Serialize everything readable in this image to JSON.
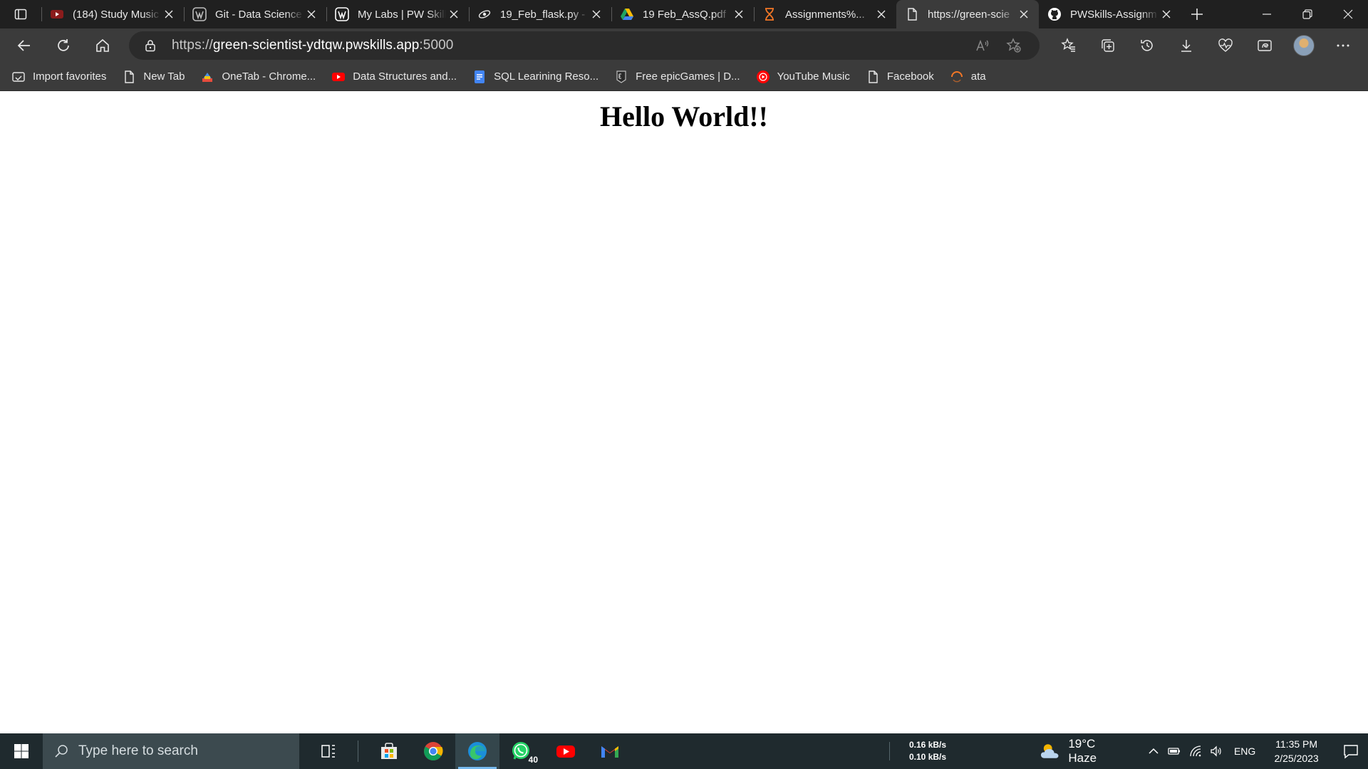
{
  "browser": {
    "tabs": [
      {
        "title": "(184) Study Music",
        "icon": "youtube-icon",
        "active": false
      },
      {
        "title": "Git - Data Science",
        "icon": "wordpress-icon",
        "active": false
      },
      {
        "title": "My Labs | PW Skills",
        "icon": "wordpress-icon",
        "active": false
      },
      {
        "title": "19_Feb_flask.py - ",
        "icon": "jupyter-icon",
        "active": false
      },
      {
        "title": "19 Feb_AssQ.pdf",
        "icon": "google-drive-icon",
        "active": false
      },
      {
        "title": "Assignments%...",
        "icon": "hourglass-icon",
        "active": false
      },
      {
        "title": "https://green-scie",
        "icon": "page-icon",
        "active": true
      },
      {
        "title": "PWSkills-Assignm",
        "icon": "github-icon",
        "active": false
      }
    ],
    "address": {
      "scheme": "https://",
      "host": "green-scientist-ydtqw.pwskills.app",
      "port": ":5000"
    },
    "favorites": [
      {
        "label": "Import favorites",
        "icon": "import-favorites-icon"
      },
      {
        "label": "New Tab",
        "icon": "page-icon"
      },
      {
        "label": "OneTab - Chrome...",
        "icon": "onetab-icon"
      },
      {
        "label": "Data Structures and...",
        "icon": "youtube-icon"
      },
      {
        "label": "SQL Learining Reso...",
        "icon": "google-docs-icon"
      },
      {
        "label": "Free epicGames | D...",
        "icon": "epic-games-icon"
      },
      {
        "label": "YouTube Music",
        "icon": "youtube-music-icon"
      },
      {
        "label": "Facebook",
        "icon": "page-icon"
      },
      {
        "label": "ata",
        "icon": "loading-icon"
      }
    ]
  },
  "page": {
    "heading": "Hello World!!"
  },
  "taskbar": {
    "search_placeholder": "Type here to search",
    "apps": [
      {
        "name": "task-view",
        "icon": "task-view-icon"
      },
      {
        "name": "microsoft-store",
        "icon": "store-icon"
      },
      {
        "name": "chrome",
        "icon": "chrome-icon"
      },
      {
        "name": "edge",
        "icon": "edge-icon",
        "active": true
      },
      {
        "name": "whatsapp",
        "icon": "whatsapp-icon",
        "badge": "40"
      },
      {
        "name": "youtube",
        "icon": "youtube-icon"
      },
      {
        "name": "gmail",
        "icon": "gmail-icon"
      }
    ],
    "net_up": "0.16 kB/s",
    "net_down": "0.10 kB/s",
    "weather": "19°C  Haze",
    "language": "ENG",
    "time": "11:35 PM",
    "date": "2/25/2023"
  },
  "colors": {
    "tabstrip": "#202020",
    "toolbar": "#3b3b3b",
    "taskbar": "#1f2a2e",
    "accent": "#76b9ed"
  }
}
